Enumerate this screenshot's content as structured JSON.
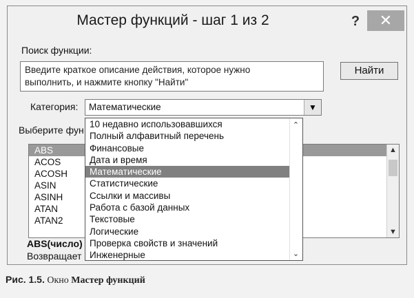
{
  "dialog": {
    "title": "Мастер функций - шаг 1 из 2",
    "help": "?",
    "close": "✕"
  },
  "search": {
    "label": "Поиск функции:",
    "placeholder_line1": "Введите краткое описание действия, которое нужно",
    "placeholder_line2": "выполнить, и нажмите кнопку \"Найти\"",
    "find_button": "Найти"
  },
  "category": {
    "label": "Категория:",
    "selected": "Математические",
    "options": [
      "10 недавно использовавшихся",
      "Полный алфавитный перечень",
      "Финансовые",
      "Дата и время",
      "Математические",
      "Статистические",
      "Ссылки и массивы",
      "Работа с базой данных",
      "Текстовые",
      "Логические",
      "Проверка свойств и значений",
      "Инженерные"
    ]
  },
  "functions": {
    "label": "Выберите фун",
    "items": [
      "ABS",
      "ACOS",
      "ACOSH",
      "ASIN",
      "ASINH",
      "ATAN",
      "ATAN2"
    ],
    "syntax": "ABS(число)",
    "description": "Возвращает"
  },
  "caption": {
    "number": "Рис. 1.5.",
    "text": "Окно",
    "bold": "Мастер функций"
  }
}
